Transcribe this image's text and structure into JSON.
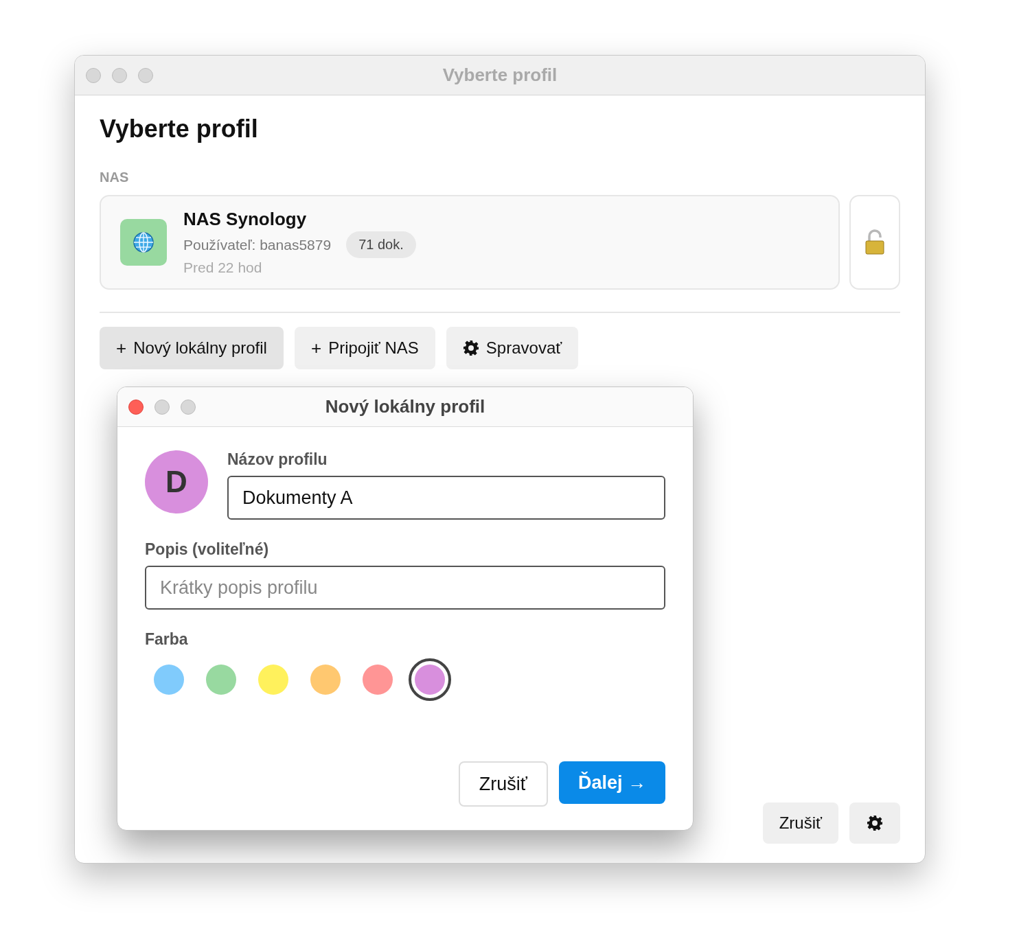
{
  "window": {
    "title": "Vyberte profil"
  },
  "heading": "Vyberte profil",
  "section_label": "NAS",
  "nas_profile": {
    "name": "NAS Synology",
    "user": "Používateľ: banas5879",
    "badge": "71 dok.",
    "updated": "Pred 22 hod"
  },
  "actions": [
    {
      "kind": "plus",
      "label": "Nový lokálny profil",
      "plus": "+"
    },
    {
      "kind": "plus",
      "label": "Pripojiť NAS",
      "plus": "+"
    },
    {
      "kind": "gear",
      "label": "Spravovať"
    }
  ],
  "footer": {
    "cancel": "Zrušiť"
  },
  "dialog": {
    "title": "Nový lokálny profil",
    "avatar_letter": "D",
    "name_label": "Názov profilu",
    "name_value": "Dokumenty A",
    "description_label": "Popis (voliteľné)",
    "description_placeholder": "Krátky popis profilu",
    "color_label": "Farba",
    "colors": [
      {
        "color": "#80cbfc",
        "selected": false
      },
      {
        "color": "#98d9a0",
        "selected": false
      },
      {
        "color": "#fff15c",
        "selected": false
      },
      {
        "color": "#ffc870",
        "selected": false
      },
      {
        "color": "#ff9595",
        "selected": false
      },
      {
        "color": "#d88fdd",
        "selected": true
      }
    ],
    "cancel": "Zrušiť",
    "next": "Ďalej →"
  }
}
